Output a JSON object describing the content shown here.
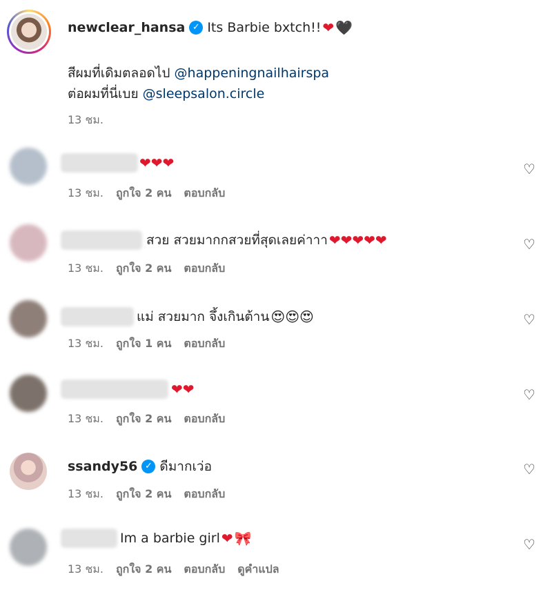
{
  "caption": {
    "username": "newclear_hansa",
    "text": "Its Barbie bxtch!! ",
    "line2_text": "สีผมที่เดิมตลอดไป ",
    "line2_mention": "@happeningnailhairspa",
    "line3_text": "ต่อผมที่นี่เบย ",
    "line3_mention": "@sleepsalon.circle",
    "time": "13 ชม."
  },
  "comments": [
    {
      "text": "",
      "time": "13 ชม.",
      "likes": "ถูกใจ 2 คน",
      "reply": "ตอบกลับ"
    },
    {
      "text": "สวย สวยมากกสวยที่สุดเลยค่าาา",
      "time": "13 ชม.",
      "likes": "ถูกใจ 2 คน",
      "reply": "ตอบกลับ"
    },
    {
      "text": "แม่ สวยมาก จึ้งเกินต้าน",
      "time": "13 ชม.",
      "likes": "ถูกใจ 1 คน",
      "reply": "ตอบกลับ"
    },
    {
      "text": "",
      "time": "13 ชม.",
      "likes": "ถูกใจ 2 คน",
      "reply": "ตอบกลับ"
    },
    {
      "username": "ssandy56",
      "text": "ดีมากเว่อ",
      "time": "13 ชม.",
      "likes": "ถูกใจ 2 คน",
      "reply": "ตอบกลับ"
    },
    {
      "text": "Im a barbie girl ",
      "time": "13 ชม.",
      "likes": "ถูกใจ 2 คน",
      "reply": "ตอบกลับ",
      "translate": "ดูคำแปล"
    }
  ],
  "icons": {
    "like": "heart-outline-icon",
    "verified": "verified-badge-icon"
  },
  "colors": {
    "link": "#00376b",
    "verified": "#0095f6",
    "meta": "#737373"
  }
}
